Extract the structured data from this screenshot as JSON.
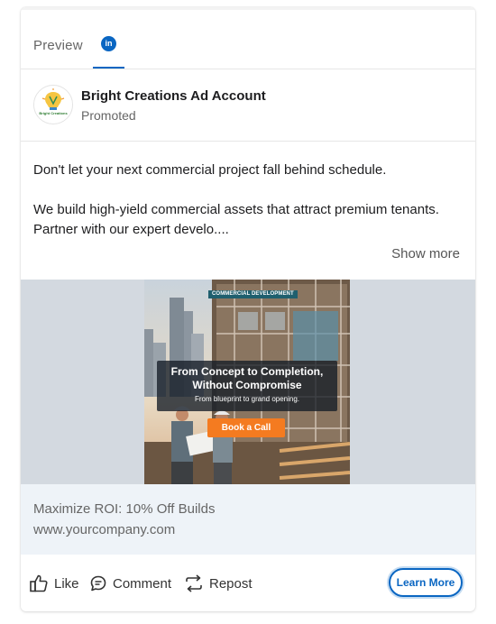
{
  "tabs": {
    "preview_label": "Preview",
    "linkedin_icon_text": "in",
    "icons": {
      "linkedin": "linkedin-icon"
    }
  },
  "account": {
    "name": "Bright Creations Ad Account",
    "subtitle": "Promoted",
    "logo_text": "Bright Creations",
    "logo_icon": "lightbulb-icon"
  },
  "post": {
    "paragraph1": "Don't let your next commercial project fall behind schedule.",
    "paragraph2": "We build high-yield commercial assets that attract premium tenants. Partner with our expert develo....",
    "show_more": "Show more"
  },
  "creative": {
    "badge": "COMMERCIAL DEVELOPMENT",
    "headline_line1": "From Concept to Completion,",
    "headline_line2": "Without Compromise",
    "subline": "From blueprint to grand opening.",
    "cta": "Book a Call"
  },
  "link": {
    "headline": "Maximize ROI: 10% Off Builds",
    "url": "www.yourcompany.com"
  },
  "actions": {
    "like": "Like",
    "comment": "Comment",
    "repost": "Repost",
    "learn_more": "Learn More"
  },
  "colors": {
    "linkedin_blue": "#0a66c2",
    "cta_orange": "#f47b20",
    "link_area_bg": "#eef3f8",
    "creative_bg": "#d3d9e0"
  }
}
